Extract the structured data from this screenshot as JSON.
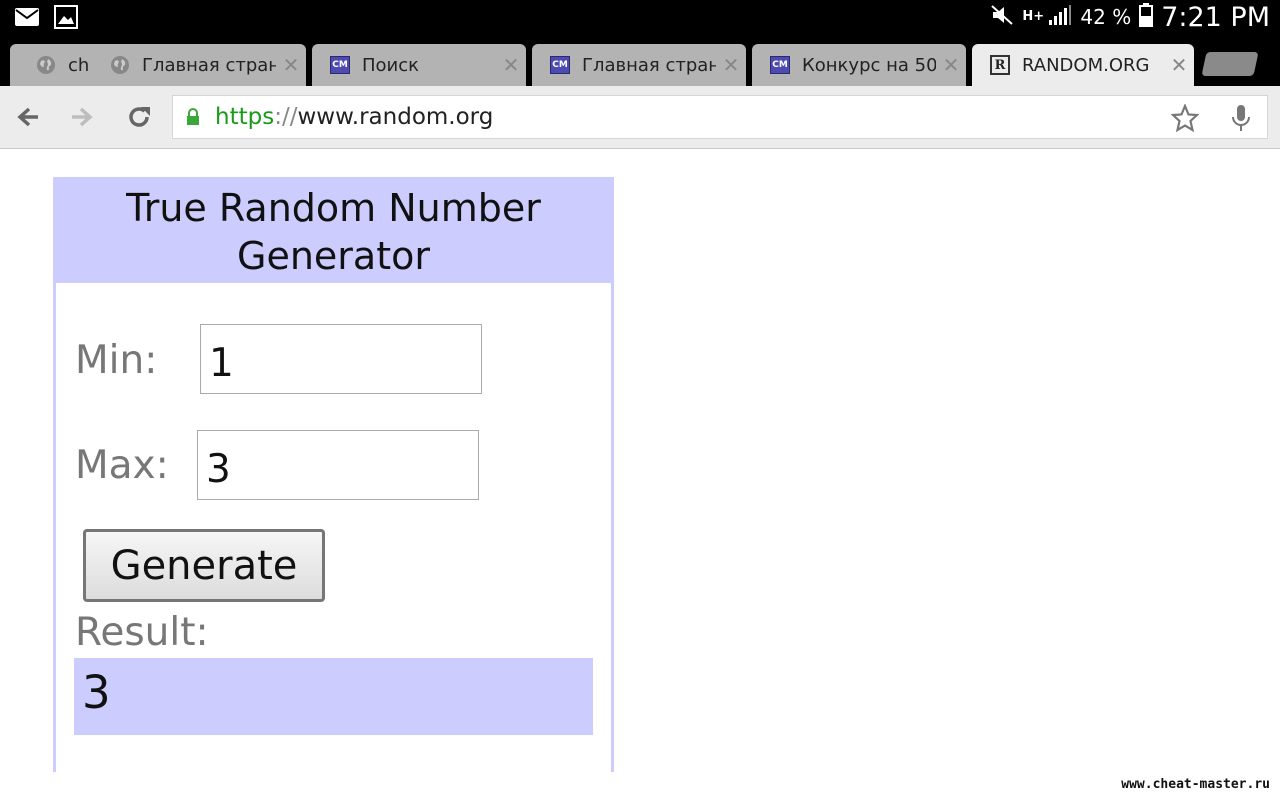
{
  "status_bar": {
    "time": "7:21 PM",
    "battery_percent": "42 %",
    "network": "H+",
    "icons": [
      "mail-icon",
      "image-icon",
      "mute-icon",
      "network-icon",
      "signal-icon",
      "battery-icon"
    ]
  },
  "tabs": [
    {
      "label": "ch",
      "icon": "globe-icon",
      "active": false
    },
    {
      "label": "Главная стран",
      "icon": "globe-icon",
      "active": false
    },
    {
      "label": "Поиск",
      "icon": "cm-icon",
      "active": false
    },
    {
      "label": "Главная стран",
      "icon": "cm-icon",
      "active": false
    },
    {
      "label": "Конкурс на 50",
      "icon": "cm-icon",
      "active": false
    },
    {
      "label": "RANDOM.ORG",
      "icon": "random-org-icon",
      "active": true
    }
  ],
  "toolbar": {
    "url_scheme": "https",
    "url_sep": "://",
    "url_host": "www.random.org"
  },
  "generator": {
    "title_line1": "True Random Number",
    "title_line2": "Generator",
    "min_label": "Min:",
    "min_value": "1",
    "max_label": "Max:",
    "max_value": "3",
    "generate_label": "Generate",
    "result_label": "Result:",
    "result_value": "3"
  },
  "watermark": "www.cheat-master.ru"
}
